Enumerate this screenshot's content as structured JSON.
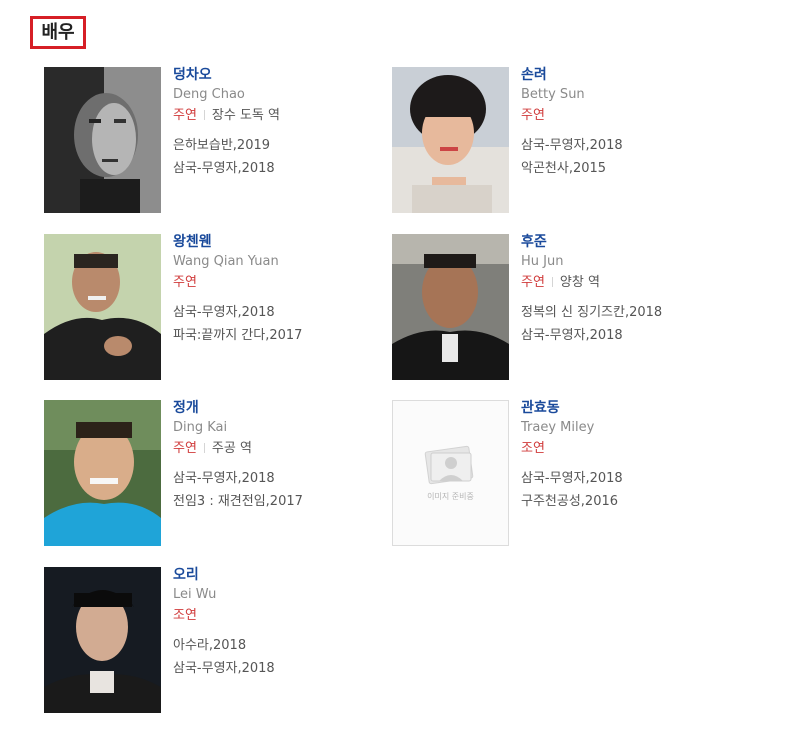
{
  "section": {
    "title": "배우"
  },
  "actors": [
    {
      "name": "덩차오",
      "english": "Deng Chao",
      "role": "주연",
      "character": "장수 도독 역",
      "works": [
        "은하보습반,2019",
        "삼국-무영자,2018"
      ],
      "photo": "portrait-photo"
    },
    {
      "name": "손려",
      "english": "Betty Sun",
      "role": "주연",
      "character": "",
      "works": [
        "삼국-무영자,2018",
        "악곤천사,2015"
      ],
      "photo": "portrait-photo"
    },
    {
      "name": "왕첸웬",
      "english": "Wang Qian Yuan",
      "role": "주연",
      "character": "",
      "works": [
        "삼국-무영자,2018",
        "파국:끝까지 간다,2017"
      ],
      "photo": "portrait-photo"
    },
    {
      "name": "후준",
      "english": "Hu Jun",
      "role": "주연",
      "character": "양창 역",
      "works": [
        "정복의 신 징기즈칸,2018",
        "삼국-무영자,2018"
      ],
      "photo": "portrait-photo"
    },
    {
      "name": "정개",
      "english": "Ding Kai",
      "role": "주연",
      "character": "주공 역",
      "works": [
        "삼국-무영자,2018",
        "전임3 : 재견전임,2017"
      ],
      "photo": "portrait-photo"
    },
    {
      "name": "관효동",
      "english": "Traey Miley",
      "role": "조연",
      "character": "",
      "works": [
        "삼국-무영자,2018",
        "구주천공성,2016"
      ],
      "photo": "image-placeholder",
      "placeholder_text": "이미지 준비중"
    },
    {
      "name": "오리",
      "english": "Lei Wu",
      "role": "조연",
      "character": "",
      "works": [
        "아수라,2018",
        "삼국-무영자,2018"
      ],
      "photo": "portrait-photo"
    }
  ],
  "colors": {
    "title_border": "#d61f26",
    "name": "#1a4a9b",
    "role": "#d03b3b",
    "english": "#8a8a8a"
  }
}
